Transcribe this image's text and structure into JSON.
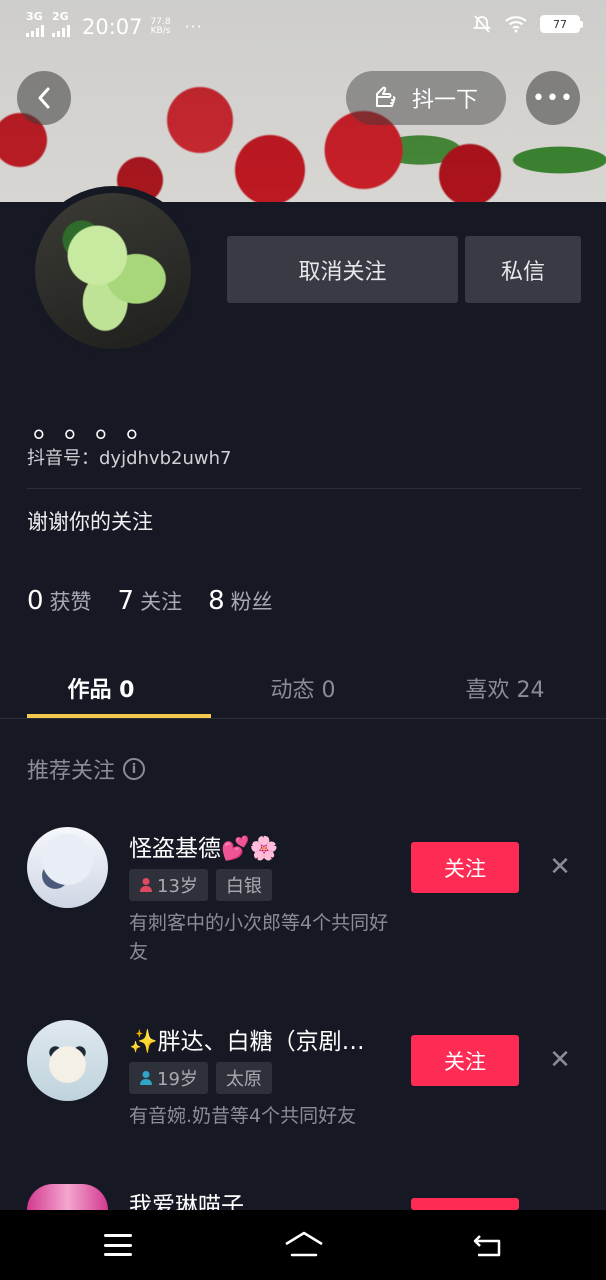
{
  "status_bar": {
    "network1": "3G",
    "network2": "2G",
    "time": "20:07",
    "speed_value": "77.8",
    "speed_unit": "KB/s",
    "dots": "···",
    "battery": "77"
  },
  "header": {
    "douyixia_label": "抖一下",
    "more_label": "•••"
  },
  "profile": {
    "unfollow_label": "取消关注",
    "message_label": "私信",
    "nickname": "。。。。",
    "douyin_id": "抖音号：dyjdhvb2uwh7",
    "bio": "谢谢你的关注"
  },
  "stats": [
    {
      "num": "0",
      "label": "获赞"
    },
    {
      "num": "7",
      "label": "关注"
    },
    {
      "num": "8",
      "label": "粉丝"
    }
  ],
  "tabs": [
    {
      "label": "作品 0"
    },
    {
      "label": "动态 0"
    },
    {
      "label": "喜欢 24"
    }
  ],
  "recommend": {
    "title": "推荐关注",
    "info_icon": "i",
    "items": [
      {
        "name": "怪盗基德💕🌸",
        "age": "13岁",
        "gender_color": "#e0485f",
        "tag2": "白银",
        "desc": "有刺客中的小次郎等4个共同好友",
        "follow_label": "关注",
        "close": "✕"
      },
      {
        "name": "✨胖达、白糖（京剧…",
        "age": "19岁",
        "gender_color": "#2fa6c8",
        "tag2": "太原",
        "desc": "有音婉.奶昔等4个共同好友",
        "follow_label": "关注",
        "close": "✕"
      },
      {
        "name": "我爱琳喵子"
      }
    ]
  }
}
